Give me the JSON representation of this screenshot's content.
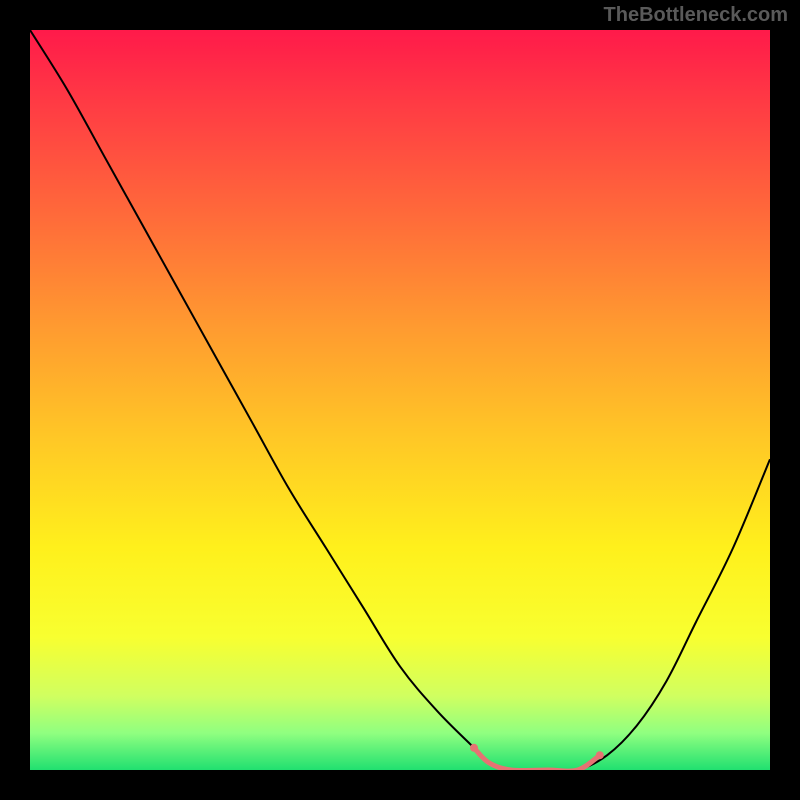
{
  "watermark": "TheBottleneck.com",
  "chart_data": {
    "type": "line",
    "title": "",
    "xlabel": "",
    "ylabel": "",
    "xlim": [
      0,
      100
    ],
    "ylim": [
      0,
      100
    ],
    "gradient_stops": [
      {
        "offset": 0.0,
        "color": "#ff1a4a"
      },
      {
        "offset": 0.1,
        "color": "#ff3b44"
      },
      {
        "offset": 0.25,
        "color": "#ff6a3a"
      },
      {
        "offset": 0.4,
        "color": "#ff9a30"
      },
      {
        "offset": 0.55,
        "color": "#ffc726"
      },
      {
        "offset": 0.7,
        "color": "#fff01c"
      },
      {
        "offset": 0.82,
        "color": "#f8ff30"
      },
      {
        "offset": 0.9,
        "color": "#d0ff60"
      },
      {
        "offset": 0.95,
        "color": "#90ff80"
      },
      {
        "offset": 1.0,
        "color": "#20e070"
      }
    ],
    "series": [
      {
        "name": "bottleneck-curve",
        "color": "#000000",
        "x": [
          0,
          5,
          10,
          15,
          20,
          25,
          30,
          35,
          40,
          45,
          50,
          55,
          60,
          62,
          65,
          70,
          74,
          78,
          82,
          86,
          90,
          95,
          100
        ],
        "y": [
          100,
          92,
          83,
          74,
          65,
          56,
          47,
          38,
          30,
          22,
          14,
          8,
          3,
          1,
          0,
          0,
          0,
          2,
          6,
          12,
          20,
          30,
          42
        ]
      }
    ],
    "highlight_segment": {
      "name": "optimal-range",
      "color": "#e57373",
      "x": [
        60,
        62,
        65,
        70,
        74,
        77
      ],
      "y": [
        3,
        1,
        0,
        0,
        0,
        2
      ],
      "dot_radius": 4
    }
  }
}
